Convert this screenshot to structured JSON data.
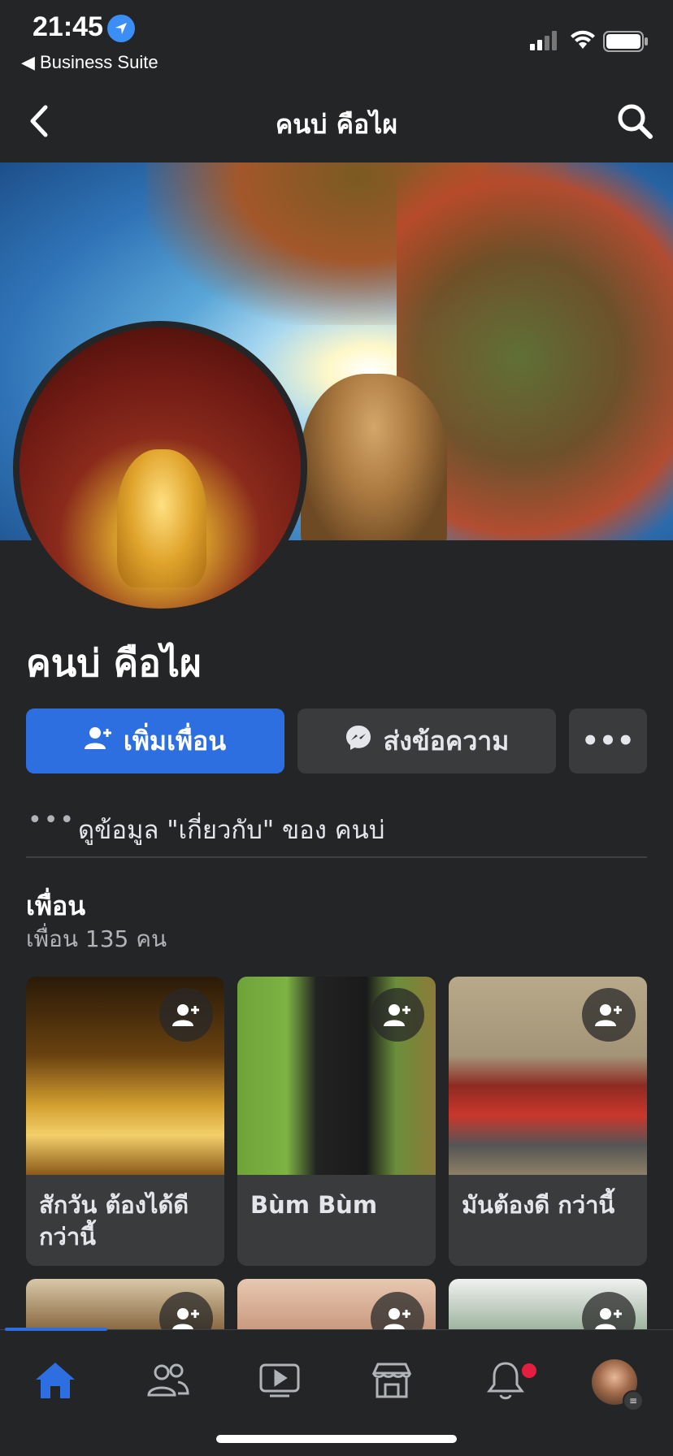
{
  "status_bar": {
    "time": "21:45",
    "back_app": "◀ Business Suite"
  },
  "header": {
    "title": "คนบ่ คือไผ"
  },
  "profile": {
    "name": "คนบ่ คือไผ"
  },
  "actions": {
    "add_friend": "เพิ่มเพื่อน",
    "message": "ส่งข้อความ",
    "more": "•••"
  },
  "about": {
    "dots": "•••",
    "text": "ดูข้อมูล \"เกี่ยวกับ\" ของ คนบ่"
  },
  "friends": {
    "title": "เพื่อน",
    "count": "เพื่อน 135 คน",
    "items": [
      {
        "name": "สักวัน ต้องได้ดี กว่านี้"
      },
      {
        "name": "Bùm Bùm"
      },
      {
        "name": "มันต้องดี กว่านี้"
      }
    ]
  },
  "tabs": [
    {
      "icon": "home-icon",
      "active": true
    },
    {
      "icon": "friends-icon",
      "active": false
    },
    {
      "icon": "watch-icon",
      "active": false
    },
    {
      "icon": "marketplace-icon",
      "active": false
    },
    {
      "icon": "notifications-icon",
      "active": false
    },
    {
      "icon": "profile-menu-icon",
      "active": false
    }
  ],
  "colors": {
    "accent": "#2d6ee0",
    "background": "#242526",
    "surface": "#3a3b3c",
    "notification": "#e41e3f"
  }
}
